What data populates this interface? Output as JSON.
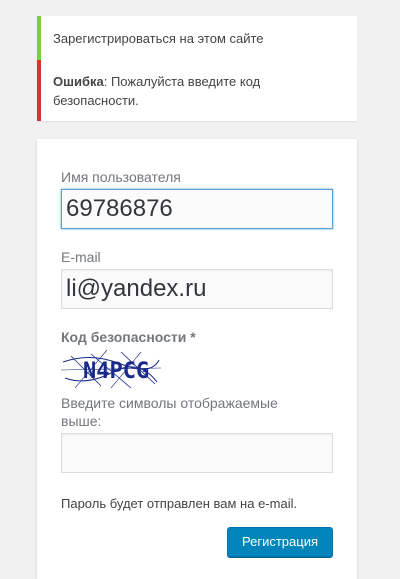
{
  "notices": {
    "message": "Зарегистрироваться на этом сайте",
    "error_label": "Ошибка",
    "error_text": ": Пожалуйста введите код безопасности."
  },
  "form": {
    "username_label": "Имя пользователя",
    "username_value": "69786876",
    "email_label": "E-mail",
    "email_value": "li@yandex.ru",
    "captcha_label": "Код безопасности *",
    "captcha_code": "N4PCG",
    "captcha_input_label": "Введите символы отображаемые выше:",
    "captcha_input_value": "",
    "hint": "Пароль будет отправлен вам на e-mail.",
    "submit_label": "Регистрация"
  },
  "colors": {
    "message_border": "#7ad03a",
    "error_border": "#dc3232",
    "button": "#0085ba"
  }
}
